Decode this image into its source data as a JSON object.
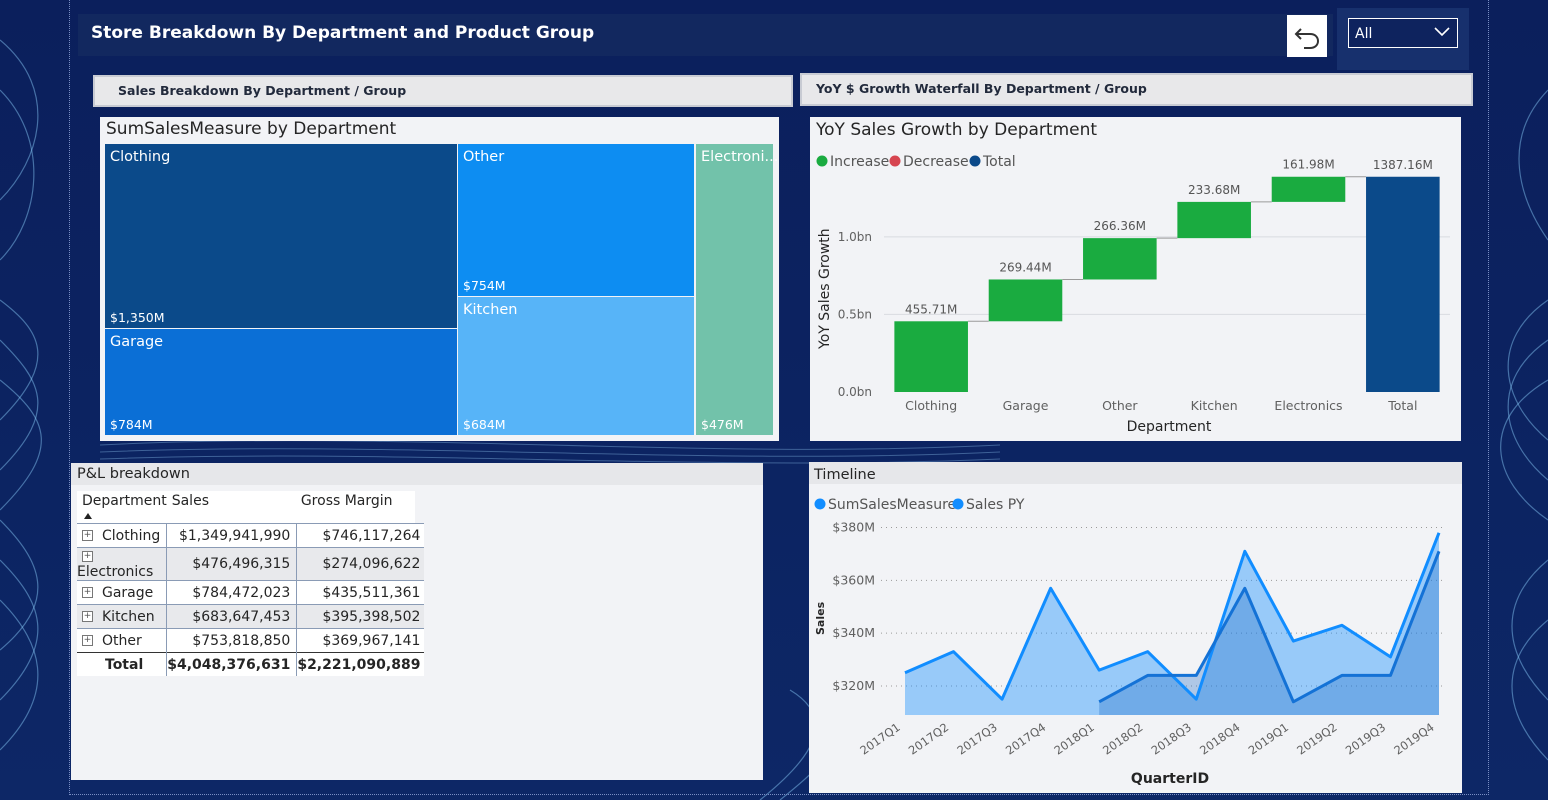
{
  "header": {
    "title": "Store Breakdown By Department and Product Group",
    "slicer_value": "All"
  },
  "sections": {
    "left_header": "Sales Breakdown By Department / Group",
    "right_header": "YoY $ Growth Waterfall By Department / Group"
  },
  "treemap": {
    "title": "SumSalesMeasure by Department",
    "tiles": [
      {
        "name": "Clothing",
        "value": "$1,350M",
        "color": "#0b4a8a"
      },
      {
        "name": "Garage",
        "value": "$784M",
        "color": "#0b6fd6"
      },
      {
        "name": "Other",
        "value": "$754M",
        "color": "#0d8df2"
      },
      {
        "name": "Kitchen",
        "value": "$684M",
        "color": "#57b4f8"
      },
      {
        "name": "Electroni...",
        "value": "$476M",
        "color": "#72c2aa"
      }
    ]
  },
  "waterfall": {
    "title": "YoY Sales Growth by Department",
    "legend": [
      {
        "label": "Increase",
        "color": "#1aab40"
      },
      {
        "label": "Decrease",
        "color": "#d64550"
      },
      {
        "label": "Total",
        "color": "#0b4a8a"
      }
    ],
    "ylabel": "YoY Sales Growth",
    "xlabel": "Department",
    "yticks": [
      "1.0bn",
      "0.5bn",
      "0.0bn"
    ]
  },
  "pl_table": {
    "title": "P&L breakdown",
    "columns": [
      "Department",
      "Sales",
      "Gross Margin"
    ],
    "rows": [
      [
        "Clothing",
        "$1,349,941,990",
        "$746,117,264"
      ],
      [
        "Electronics",
        "$476,496,315",
        "$274,096,622"
      ],
      [
        "Garage",
        "$784,472,023",
        "$435,511,361"
      ],
      [
        "Kitchen",
        "$683,647,453",
        "$395,398,502"
      ],
      [
        "Other",
        "$753,818,850",
        "$369,967,141"
      ]
    ],
    "total": [
      "Total",
      "$4,048,376,631",
      "$2,221,090,889"
    ],
    "expander_symbol": "+"
  },
  "timeline": {
    "title": "Timeline",
    "legend": [
      {
        "label": "SumSalesMeasure",
        "color": "#118dff"
      },
      {
        "label": "Sales PY",
        "color": "#118dff"
      }
    ],
    "ylabel": "Sales",
    "xlabel": "QuarterID",
    "ytick_labels": [
      "$380M",
      "$360M",
      "$340M",
      "$320M"
    ]
  },
  "chart_data": [
    {
      "type": "bar",
      "title": "YoY Sales Growth by Department",
      "xlabel": "Department",
      "ylabel": "YoY Sales Growth",
      "categories": [
        "Clothing",
        "Garage",
        "Other",
        "Kitchen",
        "Electronics",
        "Total"
      ],
      "values": [
        455.71,
        269.44,
        266.36,
        233.68,
        161.98,
        1387.16
      ],
      "labels": [
        "455.71M",
        "269.44M",
        "266.36M",
        "233.68M",
        "161.98M",
        "1387.16M"
      ],
      "value_unit": "M",
      "kinds": [
        "increase",
        "increase",
        "increase",
        "increase",
        "increase",
        "total"
      ],
      "ylim": [
        0,
        1450
      ],
      "yticks": [
        0,
        500,
        1000
      ]
    },
    {
      "type": "area",
      "title": "Timeline",
      "xlabel": "QuarterID",
      "ylabel": "Sales",
      "categories": [
        "2017Q1",
        "2017Q2",
        "2017Q3",
        "2017Q4",
        "2018Q1",
        "2018Q2",
        "2018Q3",
        "2018Q4",
        "2019Q1",
        "2019Q2",
        "2019Q3",
        "2019Q4"
      ],
      "series": [
        {
          "name": "SumSalesMeasure",
          "values": [
            325,
            333,
            315,
            357,
            326,
            333,
            315,
            371,
            337,
            343,
            331,
            378
          ]
        },
        {
          "name": "Sales PY",
          "values": [
            null,
            null,
            null,
            null,
            314,
            324,
            324,
            357,
            314,
            324,
            324,
            371
          ]
        }
      ],
      "ylim": [
        309,
        384
      ],
      "yticks": [
        320,
        340,
        360,
        380
      ]
    }
  ]
}
